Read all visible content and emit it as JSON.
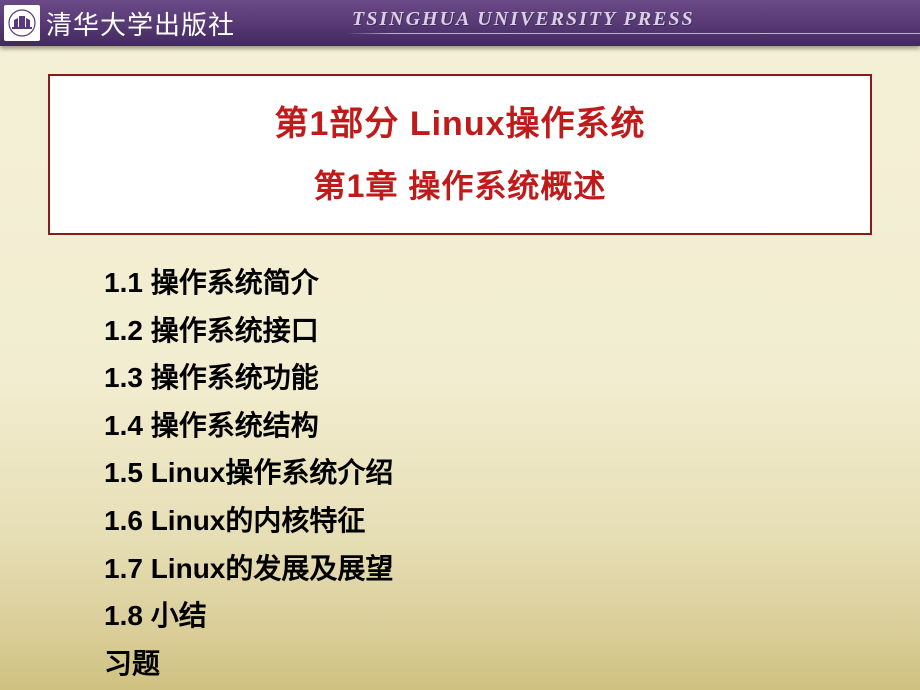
{
  "header": {
    "logo_cn": "清华大学出版社",
    "logo_en": "TSINGHUA UNIVERSITY PRESS"
  },
  "title": {
    "part": "第1部分   Linux操作系统",
    "chapter": "第1章  操作系统概述"
  },
  "toc": [
    "1.1  操作系统简介",
    "1.2  操作系统接口",
    "1.3  操作系统功能",
    "1.4  操作系统结构",
    "1.5  Linux操作系统介绍",
    "1.6  Linux的内核特征",
    "1.7  Linux的发展及展望",
    "1.8  小结",
    "习题"
  ]
}
